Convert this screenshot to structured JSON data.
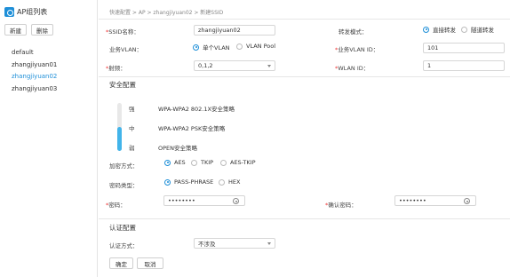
{
  "sidebar": {
    "title": "AP组列表",
    "new_button": "新建",
    "delete_button": "删除",
    "items": [
      {
        "label": "default",
        "active": false
      },
      {
        "label": "zhangjiyuan01",
        "active": false
      },
      {
        "label": "zhangjiyuan02",
        "active": true
      },
      {
        "label": "zhangjiyuan03",
        "active": false
      }
    ]
  },
  "breadcrumb": "快速配置 > AP > zhangjiyuan02 > 新建SSID",
  "form": {
    "ssid_label": "SSID名称：",
    "ssid_value": "zhangjiyuan02",
    "forward_label": "转发模式：",
    "forward_options": [
      "直接转发",
      "隧道转发"
    ],
    "forward_selected": 0,
    "vlan_label": "业务VLAN：",
    "vlan_options": [
      "单个VLAN",
      "VLAN Pool"
    ],
    "vlan_selected": 0,
    "vlan_id_label": "业务VLAN ID：",
    "vlan_id_value": "101",
    "radio_label": "射频：",
    "radio_value": "0,1,2",
    "wlan_id_label": "WLAN ID：",
    "wlan_id_value": "1"
  },
  "security": {
    "section_title": "安全配置",
    "strength_labels": [
      "强",
      "中",
      "弱"
    ],
    "strength_level": 0.5,
    "strength_descs": [
      "WPA-WPA2 802.1X安全策略",
      "WPA-WPA2 PSK安全策略",
      "OPEN安全策略"
    ],
    "encryption_label": "加密方式：",
    "encryption_options": [
      "AES",
      "TKIP",
      "AES-TKIP"
    ],
    "encryption_selected": 0,
    "pwd_type_label": "密码类型：",
    "pwd_type_options": [
      "PASS-PHRASE",
      "HEX"
    ],
    "pwd_type_selected": 0,
    "password_label": "密码：",
    "password_value": "••••••••",
    "confirm_label": "确认密码：",
    "confirm_value": "••••••••"
  },
  "auth": {
    "section_title": "认证配置",
    "mode_label": "认证方式：",
    "mode_value": "不涉及"
  },
  "buttons": {
    "ok": "确定",
    "cancel": "取消"
  },
  "colors": {
    "accent": "#1e8fd8",
    "strength_bar": "#42b4ea",
    "required": "#ee3333"
  }
}
